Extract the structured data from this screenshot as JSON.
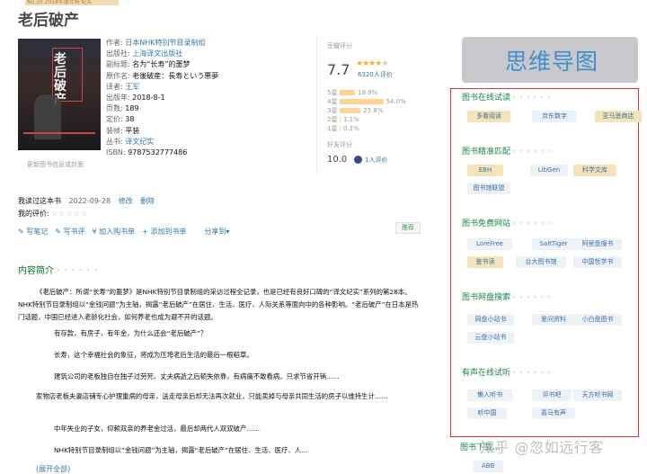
{
  "banner": "No.10  2018年度社科·纪实",
  "book": {
    "title": "老后破产",
    "cover_title": "老后破产",
    "cover_caption": "更新图书信息或封面",
    "meta": [
      {
        "label": "作者: ",
        "value": "日本NHK特别节目录制组",
        "link": true
      },
      {
        "label": "出版社: ",
        "value": "上海译文出版社",
        "link": true
      },
      {
        "label": "副标题: ",
        "value": "名为“长寿”的噩梦",
        "link": false
      },
      {
        "label": "原作名: ",
        "value": "老後破産：長寿という悪夢",
        "link": false
      },
      {
        "label": "译者: ",
        "value": "王军",
        "link": true
      },
      {
        "label": "出版年: ",
        "value": "2018-8-1",
        "link": false
      },
      {
        "label": "页数: ",
        "value": "189",
        "link": false
      },
      {
        "label": "定价: ",
        "value": "38",
        "link": false
      },
      {
        "label": "装帧: ",
        "value": "平装",
        "link": false
      },
      {
        "label": "丛书: ",
        "value": "译文纪实",
        "link": true
      },
      {
        "label": "ISBN: ",
        "value": "9787532777486",
        "link": false
      }
    ]
  },
  "rating": {
    "label": "豆瓣评分",
    "score": "7.7",
    "stars": 4,
    "count": "6320人评价",
    "bars": [
      {
        "label": "5星",
        "pct": "18.9%",
        "value": 18.9
      },
      {
        "label": "4星",
        "pct": "54.0%",
        "value": 54.0
      },
      {
        "label": "3星",
        "pct": "25.8%",
        "value": 25.8
      },
      {
        "label": "2星",
        "pct": "1.1%",
        "value": 1.1
      },
      {
        "label": "1星",
        "pct": "0.2%",
        "value": 0.2
      }
    ],
    "friend_label": "好友评分",
    "friend_score": "10.0",
    "friend_count": "1人评价"
  },
  "status": {
    "read": "我读过这本书",
    "date": "2022-09-28",
    "edit": "修改",
    "delete": "删除",
    "my_rating": "我的评价: "
  },
  "actions": {
    "note": "写笔记",
    "review": "写书评",
    "buy": "加入购书单",
    "booklist": "添加到书单",
    "share": "分享到",
    "recommend": "推荐"
  },
  "intro": {
    "heading": "内容简介",
    "dots": "· · · · · ·",
    "paragraphs": [
      "《老后破产：所谓“长寿”的噩梦》是NHK特别节目录制组的采访过程全记录，也是已经有良好口碑的“译文纪实”系列的第28本。NHK特别节目录制组以“金钱问题”为主轴，揭露“老后破产”在居住、生活、医疗、人际关系等面向中的各种影响。“老后破产”在日本是热门话题，中国已经进入老龄化社会，如何养老也成为避不开的话题。",
      "有存款，有房子，有年金，为什么还会“老后破产”？",
      "长寿，这个幸福社会的象征，将成为压垮老后生活的最后一根稻草。",
      "建筑公司的老板独自在独子过劳死、丈夫病逝之后顿失依靠，有病痛不敢看病，只求节省开销……",
      "家物店老板夫妻店铺专心护理重病的母亲，送走母亲后却无法再次就业，只能卖掉与母亲共同生活的房子以维持生计……",
      "中年失业的子女，仰赖双亲的养老金过活，最后却两代人双双破产……",
      "NHK特别节目录制组以“金钱问题”为主轴，揭露“老后破产”在居住、生活、医疗、人..."
    ],
    "expand": "(展开全部)"
  },
  "mindmap_label": "思维导图",
  "panel": {
    "sections": [
      {
        "heading": "图书在线试读",
        "chips": [
          [
            "多看阅读",
            "gold"
          ],
          [
            "京东数字",
            "grey"
          ],
          [
            "亚马逊商店",
            "gold"
          ]
        ]
      },
      {
        "heading": "图书精准匹配",
        "chips": [
          [
            "EBH",
            "gold"
          ],
          [
            "LibGen",
            "grey"
          ],
          [
            "科学文库",
            "gold"
          ],
          [
            "图书馆联盟",
            "grey"
          ]
        ]
      },
      {
        "heading": "图书免费网站",
        "chips": [
          [
            "LoreFree",
            "grey"
          ],
          [
            "SaltTiger",
            "grey"
          ],
          [
            "阿里盘搜书",
            "grey"
          ],
          [
            "鉴书读",
            "gold"
          ],
          [
            "台大图书馆",
            "grey"
          ],
          [
            "中国哲学书",
            "grey"
          ]
        ]
      },
      {
        "heading": "图书网盘搜索",
        "chips": [
          [
            "网盘小站书",
            "grey"
          ],
          [
            "爱问资料",
            "grey"
          ],
          [
            "小白盘图书",
            "grey"
          ],
          [
            "云盘小站书",
            "grey"
          ]
        ]
      },
      {
        "heading": "有声在线试听",
        "chips": [
          [
            "懒人听书",
            "grey"
          ],
          [
            "评书吧",
            "grey"
          ],
          [
            "天方听书网",
            "grey"
          ],
          [
            "听中国",
            "grey"
          ],
          [
            "喜马有声",
            "grey"
          ]
        ]
      }
    ],
    "dots": "· · · · · ·"
  },
  "below": {
    "heading": "图书下载...",
    "chip": "ABB"
  },
  "watermark": "知乎 @忽如远行客"
}
